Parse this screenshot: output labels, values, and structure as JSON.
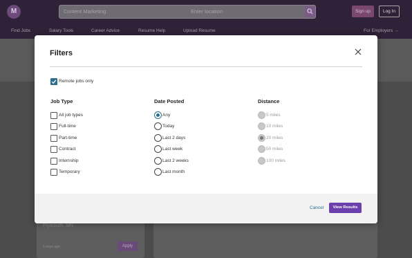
{
  "header": {
    "logo_letter": "M",
    "search_keyword": "Content Marketing",
    "search_location_placeholder": "Enter location",
    "signup_label": "Sign up",
    "login_label": "Log In"
  },
  "nav": {
    "items": [
      "Find Jobs",
      "Salary Tools",
      "Career Advice",
      "Resume Help",
      "Upload Resume"
    ],
    "employers_label": "For Employers →"
  },
  "background_card": {
    "city": "Plymouth, MN",
    "age": "5 days ago",
    "apply_label": "Apply"
  },
  "modal": {
    "title": "Filters",
    "remote_label": "Remote jobs only",
    "remote_checked": true,
    "job_type": {
      "heading": "Job Type",
      "options": [
        "All job types",
        "Full-time",
        "Part-time",
        "Contract",
        "Internship",
        "Temporary"
      ]
    },
    "date_posted": {
      "heading": "Date Posted",
      "options": [
        "Any",
        "Today",
        "Last 2 days",
        "Last week",
        "Last 2 weeks",
        "Last month"
      ],
      "selected": "Any"
    },
    "distance": {
      "heading": "Distance",
      "options": [
        "5 miles",
        "10 miles",
        "20 miles",
        "50 miles",
        "100 miles"
      ],
      "selected": "20 miles"
    },
    "cancel_label": "Cancel",
    "view_results_label": "View Results"
  },
  "colors": {
    "accent_purple": "#6c3fae",
    "teal": "#2b6f8c",
    "header_bg": "#2f2137"
  }
}
